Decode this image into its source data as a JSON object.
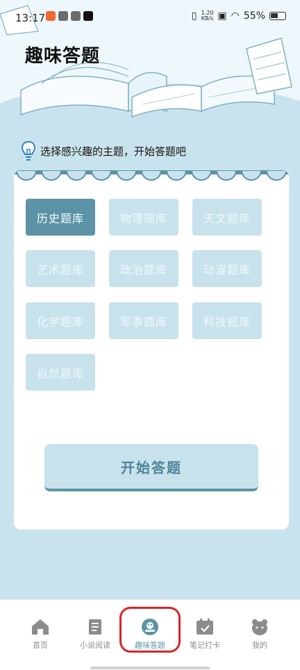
{
  "status_bar": {
    "time": "13:17",
    "net_speed_value": "1.20",
    "net_speed_unit": "KB/s",
    "battery": "55%"
  },
  "header": {
    "title": "趣味答题"
  },
  "prompt": {
    "text": "选择感兴趣的主题，开始答题吧"
  },
  "topics": [
    {
      "label": "历史题库",
      "selected": true
    },
    {
      "label": "物理题库",
      "selected": false
    },
    {
      "label": "天文题库",
      "selected": false
    },
    {
      "label": "艺术题库",
      "selected": false
    },
    {
      "label": "政治题库",
      "selected": false
    },
    {
      "label": "动漫题库",
      "selected": false
    },
    {
      "label": "化学题库",
      "selected": false
    },
    {
      "label": "军事题库",
      "selected": false
    },
    {
      "label": "科技题库",
      "selected": false
    },
    {
      "label": "自然题库",
      "selected": false
    }
  ],
  "start_button": {
    "label": "开始答题"
  },
  "tabbar": {
    "items": [
      {
        "label": "首页",
        "icon": "home-icon"
      },
      {
        "label": "小说阅读",
        "icon": "book-icon"
      },
      {
        "label": "趣味答题",
        "icon": "robot-icon"
      },
      {
        "label": "笔记打卡",
        "icon": "calendar-check-icon"
      },
      {
        "label": "我的",
        "icon": "bear-icon"
      }
    ],
    "active_index": 2
  },
  "colors": {
    "accent": "#5c93a7",
    "tile": "#c8e2ec",
    "background": "#c9e3ee",
    "highlight_ring": "#d8242b"
  }
}
